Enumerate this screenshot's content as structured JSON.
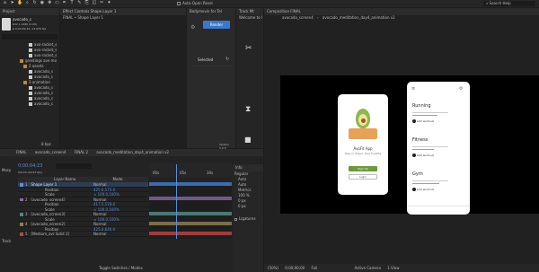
{
  "toolbar": {
    "icons": [
      "home-icon",
      "selection-icon",
      "hand-icon",
      "zoom-icon",
      "rotate-icon",
      "camera-icon",
      "pan-behind-icon",
      "rectangle-icon",
      "pen-icon",
      "type-icon",
      "brush-icon",
      "clone-icon",
      "eraser-icon",
      "roto-icon",
      "puppet-icon"
    ],
    "auto_open_label": "Auto-Open Panel",
    "search_placeholder": "Search Help"
  },
  "project": {
    "tab": "Project",
    "thumb_name": "avocado_s",
    "thumb_size": "622 x 1280 (1.00)",
    "thumb_duration": "Δ 0;00;09;15, 23.976 fps",
    "items": [
      "avo-racket_s",
      "avo-racket_s",
      "avo-racket_s",
      "greetings ave mo",
      "2 assets",
      "avocado_s",
      "avocado_s",
      "3 animation",
      "avocado_s",
      "avocado_s",
      "avocado_s",
      "avocado_s"
    ],
    "bpc": "8 bpc"
  },
  "effect_controls": {
    "tab": "Effect Controls Shape Layer 1",
    "subtitle": "FINAL • Shape Layer 1"
  },
  "bodymovin": {
    "tab": "Bodymovin for Tel",
    "render_label": "Render",
    "selected_label": "Selected",
    "footer": "Version 1.2.3"
  },
  "tracker": {
    "tab": "Track Mt",
    "subtitle": "Welcome to I"
  },
  "composition": {
    "tab": "Composition FINAL",
    "tabs": [
      "avocado_screen4",
      "avocado_meditation_day4_animation v2"
    ],
    "zoom": "(50%)",
    "time": "0;00;00;00",
    "quality": "Full",
    "camera": "Active Camera",
    "view": "1 View"
  },
  "app_left": {
    "app_title": "AvoFit App",
    "app_subtitle": "Stay in shape, stay healthy",
    "signup": "Sign Up",
    "login": "Login"
  },
  "app_right": {
    "sections": [
      {
        "title": "Running",
        "button": "Add workout"
      },
      {
        "title": "Fitness",
        "button": "Add workout"
      },
      {
        "title": "Gym",
        "button": "Add workout"
      }
    ]
  },
  "timeline": {
    "tabs": [
      "FINAL",
      "avocado_screen4",
      "FINAL 2",
      "avocado_meditation_day4_animation v2"
    ],
    "timecode": "0;00;04;23",
    "fps": "00143 (29.97 fps)",
    "column_header": "Layer Name",
    "mode_header": "Mode",
    "ruler": [
      "00s",
      "05s",
      "10s"
    ],
    "layers": [
      {
        "num": "1",
        "name": "Shape Layer 1",
        "color": "#5b8dd8",
        "mode": "Normal"
      },
      {
        "num": "",
        "name": "Position",
        "color": "",
        "mode": "425.0,575.0"
      },
      {
        "num": "",
        "name": "Scale",
        "color": "",
        "mode": "∞ 100.0,100%"
      },
      {
        "num": "2",
        "name": "[avocado_screen4]",
        "color": "#8a6aa6",
        "mode": "Normal"
      },
      {
        "num": "",
        "name": "Position",
        "color": "",
        "mode": "417.5,578.0"
      },
      {
        "num": "",
        "name": "Scale",
        "color": "",
        "mode": "∞ 100.0,100%"
      },
      {
        "num": "3",
        "name": "[avocado_screen3]",
        "color": "#4a8a86",
        "mode": "Normal"
      },
      {
        "num": "",
        "name": "Scale",
        "color": "",
        "mode": "∞ 100.0,100%"
      },
      {
        "num": "4",
        "name": "[avocado_screen2]",
        "color": "#8e7b55",
        "mode": "Normal"
      },
      {
        "num": "",
        "name": "Position",
        "color": "",
        "mode": "425.0,640.0"
      },
      {
        "num": "5",
        "name": "[Medium_avr Solid 1]",
        "color": "#b24a4a",
        "mode": "Normal"
      }
    ],
    "toggle_label": "Toggle Switches / Modes"
  },
  "info": {
    "tab": "Info",
    "label": "Regular",
    "fields": [
      "Auto",
      "Auto",
      "Metrics",
      "100 %",
      "0 px",
      "0 px"
    ],
    "ligatures_label": "Ligatures"
  },
  "menu_labels": [
    "Morp",
    "Track"
  ]
}
